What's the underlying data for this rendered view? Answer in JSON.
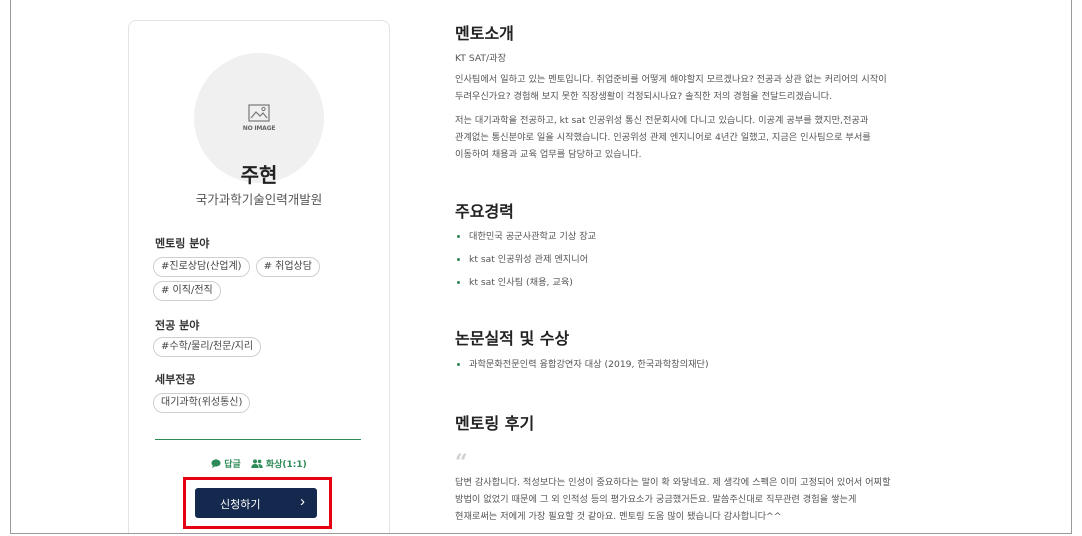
{
  "profile": {
    "no_image_label": "NO IMAGE",
    "name": "주현",
    "organization": "국가과학기술인력개발원",
    "sections": [
      {
        "label": "멘토링 분야",
        "tags": [
          "#진로상담(산업계)",
          "# 취업상담",
          "# 이직/전직"
        ]
      },
      {
        "label": "전공 분야",
        "tags": [
          "#수학/물리/천문/지리"
        ]
      },
      {
        "label": "세부전공",
        "tags": [
          "대기과학(위성통신)"
        ]
      }
    ],
    "meta": {
      "reply_label": "답글",
      "video_label": "화상(1:1)"
    },
    "apply_label": "신청하기",
    "apply_arrow": "›"
  },
  "intro": {
    "title": "멘토소개",
    "position": "KT SAT/과장",
    "paragraphs": [
      [
        "인사팀에서 일하고 있는 멘토입니다. 취업준비를 어떻게 해야할지 모르겠나요? 전공과 상관 없는 커리어의 시작이",
        "두려우신가요? 경험해 보지 못한 직장생활이 걱정되시나요? 솔직한 저의 경험을 전달드리겠습니다."
      ],
      [
        "저는 대기과학을 전공하고, kt sat 인공위성 통신 전문회사에 다니고 있습니다. 이공계 공부를 했지만,전공과",
        "관계없는 통신분야로 일을 시작했습니다. 인공위성 관제 엔지니어로 4년간 일했고, 지금은 인사팀으로 부서를",
        "이동하여 채용과 교육 업무를 담당하고 있습니다."
      ]
    ]
  },
  "career": {
    "title": "주요경력",
    "items": [
      "대한민국 공군사관학교 기상 장교",
      "kt sat 인공위성 관제 엔지니어",
      "kt sat 인사팀 (채용, 교육)"
    ]
  },
  "awards": {
    "title": "논문실적 및 수상",
    "items": [
      "과학문화전문인력 융합강연자 대상 (2019, 한국과학창의재단)"
    ]
  },
  "review": {
    "title": "멘토링 후기",
    "quote_mark": "“",
    "lines": [
      "답변 감사합니다. 적성보다는 인성이 중요하다는 말이 확 와닿네요. 제 생각에 스펙은 이미 고정되어 있어서 어찌할",
      "방법이 없었기 때문에 그 외 인적성 등의 평가요소가 궁금했거든요. 말씀주신대로 직무관련 경험을 쌓는게",
      "현재로써는 저에게 가장 필요할 것 같아요. 멘토링 도움 많이 됐습니다 감사합니다^^"
    ]
  },
  "colors": {
    "accent": "#2e8b57",
    "button": "#14294d",
    "highlight": "#e60012"
  }
}
